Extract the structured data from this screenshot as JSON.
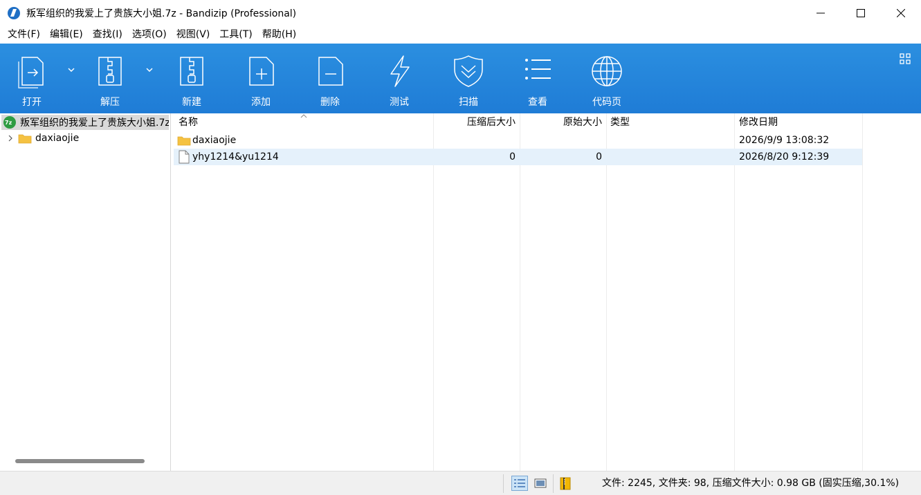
{
  "window": {
    "title": "叛军组织的我爱上了贵族大小姐.7z - Bandizip (Professional)"
  },
  "menu": {
    "items": [
      "文件(F)",
      "编辑(E)",
      "查找(I)",
      "选项(O)",
      "视图(V)",
      "工具(T)",
      "帮助(H)"
    ]
  },
  "toolbar": {
    "open": "打开",
    "extract": "解压",
    "new": "新建",
    "add": "添加",
    "delete": "删除",
    "test": "测试",
    "scan": "扫描",
    "view": "查看",
    "codepage": "代码页"
  },
  "tree": {
    "root": "叛军组织的我爱上了贵族大小姐.7z",
    "child": "daxiaojie"
  },
  "list": {
    "headers": {
      "name": "名称",
      "packed": "压缩后大小",
      "size": "原始大小",
      "type": "类型",
      "modified": "修改日期"
    },
    "rows": [
      {
        "name": "daxiaojie",
        "kind": "folder",
        "packed": "",
        "size": "",
        "type": "",
        "modified": "2026/9/9 13:08:32",
        "selected": false
      },
      {
        "name": "yhy1214&yu1214",
        "kind": "file",
        "packed": "0",
        "size": "0",
        "type": "",
        "modified": "2026/8/20 9:12:39",
        "selected": true
      }
    ]
  },
  "status": {
    "text": "文件: 2245, 文件夹: 98, 压缩文件大小: 0.98 GB (固实压缩,30.1%)"
  },
  "colors": {
    "toolbar": "#1f7cd6",
    "selection": "#e5f1fb",
    "folder": "#f5c242"
  }
}
